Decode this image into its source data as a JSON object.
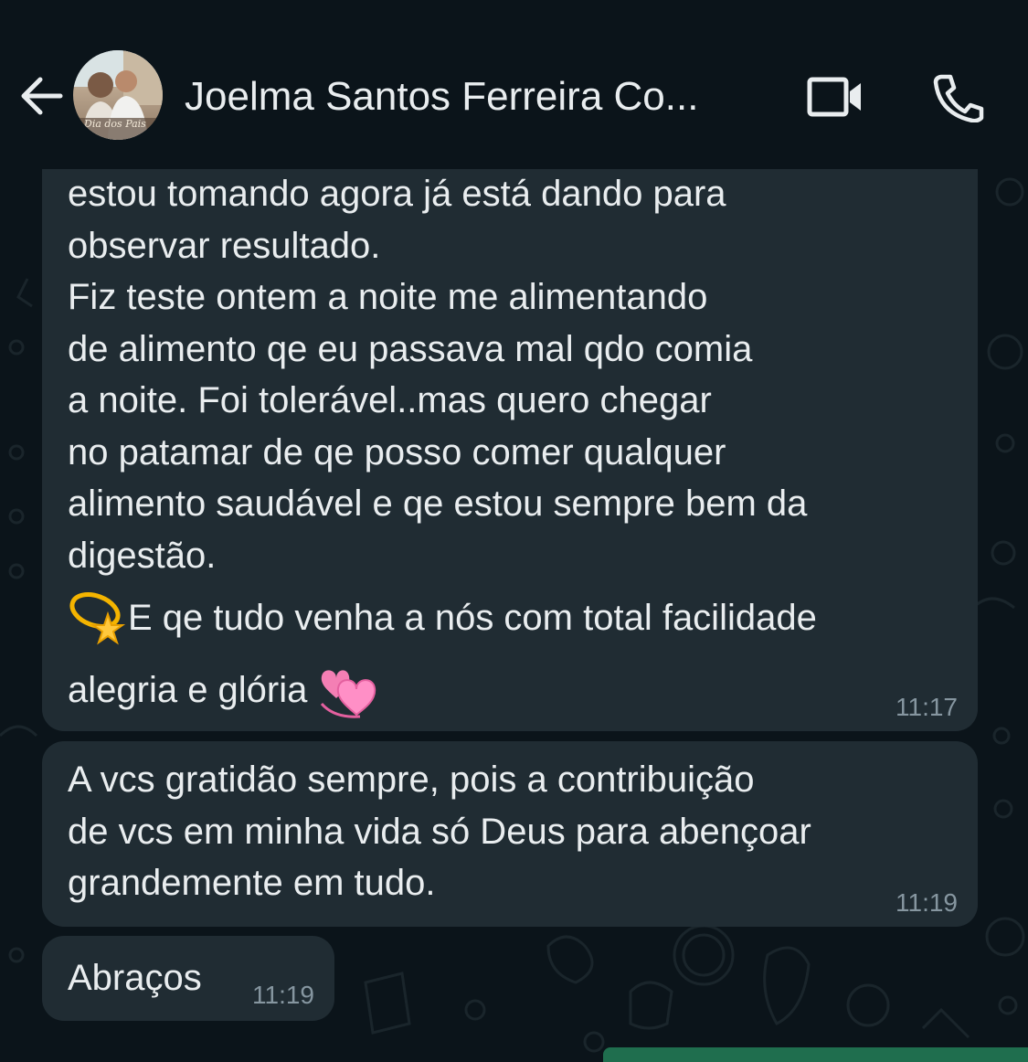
{
  "header": {
    "contact_name": "Joelma Santos Ferreira Co...",
    "avatar_caption": "Dia dos Pais",
    "back_icon": "arrow-left-icon",
    "video_icon": "video-camera-icon",
    "call_icon": "phone-icon"
  },
  "messages": [
    {
      "paragraph1": "estou tomando agora já está dando para\nobservar resultado.\nFiz teste ontem a noite me alimentando\nde alimento qe eu passava mal qdo comia\na noite. Foi tolerável..mas quero chegar\nno patamar de qe posso comer qualquer\nalimento saudável e qe estou sempre bem da\ndigestão.",
      "line_emoji1_text": "E qe tudo venha a nós com total facilidade",
      "line_emoji2_text": "alegria e glória",
      "emoji1": "dizzy-star-emoji",
      "emoji2": "revolving-hearts-emoji",
      "time": "11:17"
    },
    {
      "text": "A vcs gratidão sempre, pois a contribuição\nde vcs em minha vida só Deus para abençoar\ngrandemente em tudo.",
      "time": "11:19"
    },
    {
      "text": "Abraços",
      "time": "11:19"
    }
  ],
  "colors": {
    "background": "#0b141a",
    "bubble": "#202c33",
    "text": "#e9edef",
    "timestamp": "#8696a0",
    "accent": "#1f6e4e"
  }
}
